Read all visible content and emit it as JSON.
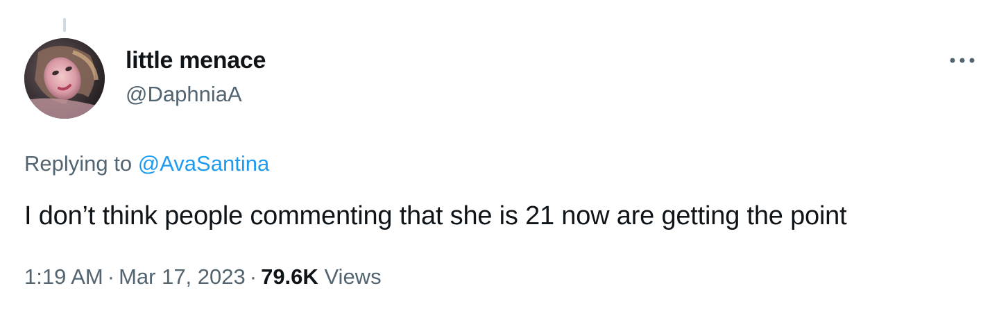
{
  "author": {
    "display_name": "little menace",
    "handle": "@DaphniaA"
  },
  "reply": {
    "prefix": "Replying to ",
    "mention": "@AvaSantina"
  },
  "tweet": {
    "text": "I don’t think people commenting that she is 21 now are getting the point"
  },
  "meta": {
    "time": "1:19 AM",
    "separator": "·",
    "date": "Mar 17, 2023",
    "views_count": "79.6K",
    "views_label": "Views"
  },
  "icons": {
    "more": "more-horizontal-icon",
    "avatar": "profile-photo"
  },
  "colors": {
    "text_primary": "#0f1419",
    "text_secondary": "#536471",
    "accent": "#1d9bf0"
  }
}
